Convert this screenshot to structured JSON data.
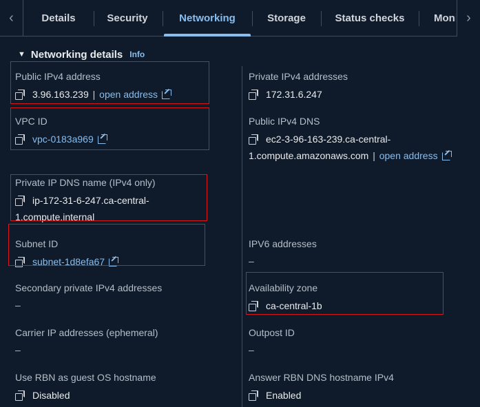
{
  "tabs": {
    "items": [
      {
        "label": "Details"
      },
      {
        "label": "Security"
      },
      {
        "label": "Networking"
      },
      {
        "label": "Storage"
      },
      {
        "label": "Status checks"
      },
      {
        "label": "Moni"
      }
    ],
    "active": "Networking",
    "scroll_left_icon": "chevron-left-icon",
    "scroll_right_icon": "chevron-right-icon"
  },
  "section": {
    "title": "Networking details",
    "info": "Info"
  },
  "fields": {
    "public_ipv4": {
      "label": "Public IPv4 address",
      "value": "3.96.163.239",
      "separator": "|",
      "link": "open address"
    },
    "private_ipv4": {
      "label": "Private IPv4 addresses",
      "value": "172.31.6.247"
    },
    "vpc_id": {
      "label": "VPC ID",
      "value": "vpc-0183a969"
    },
    "public_dns": {
      "label": "Public IPv4 DNS",
      "value_line1": "ec2-3-96-163-239.ca-central-",
      "value_line2": "1.compute.amazonaws.com",
      "separator": "|",
      "link": "open address"
    },
    "private_dns": {
      "label": "Private IP DNS name (IPv4 only)",
      "value_line1": "ip-172-31-6-247.ca-central-",
      "value_line2": "1.compute.internal"
    },
    "subnet_id": {
      "label": "Subnet ID",
      "value": "subnet-1d8efa67"
    },
    "ipv6": {
      "label": "IPV6 addresses",
      "value": "–"
    },
    "secondary_private": {
      "label": "Secondary private IPv4 addresses",
      "value": "–"
    },
    "availability_zone": {
      "label": "Availability zone",
      "value": "ca-central-1b"
    },
    "carrier_ip": {
      "label": "Carrier IP addresses (ephemeral)",
      "value": "–"
    },
    "outpost_id": {
      "label": "Outpost ID",
      "value": "–"
    },
    "rbn_hostname": {
      "label": "Use RBN as guest OS hostname",
      "value": "Disabled"
    },
    "rbn_dns": {
      "label": "Answer RBN DNS hostname IPv4",
      "value": "Enabled"
    }
  },
  "colors": {
    "background": "#0f1b2a",
    "link": "#89bdee",
    "highlight": "#d91515"
  }
}
